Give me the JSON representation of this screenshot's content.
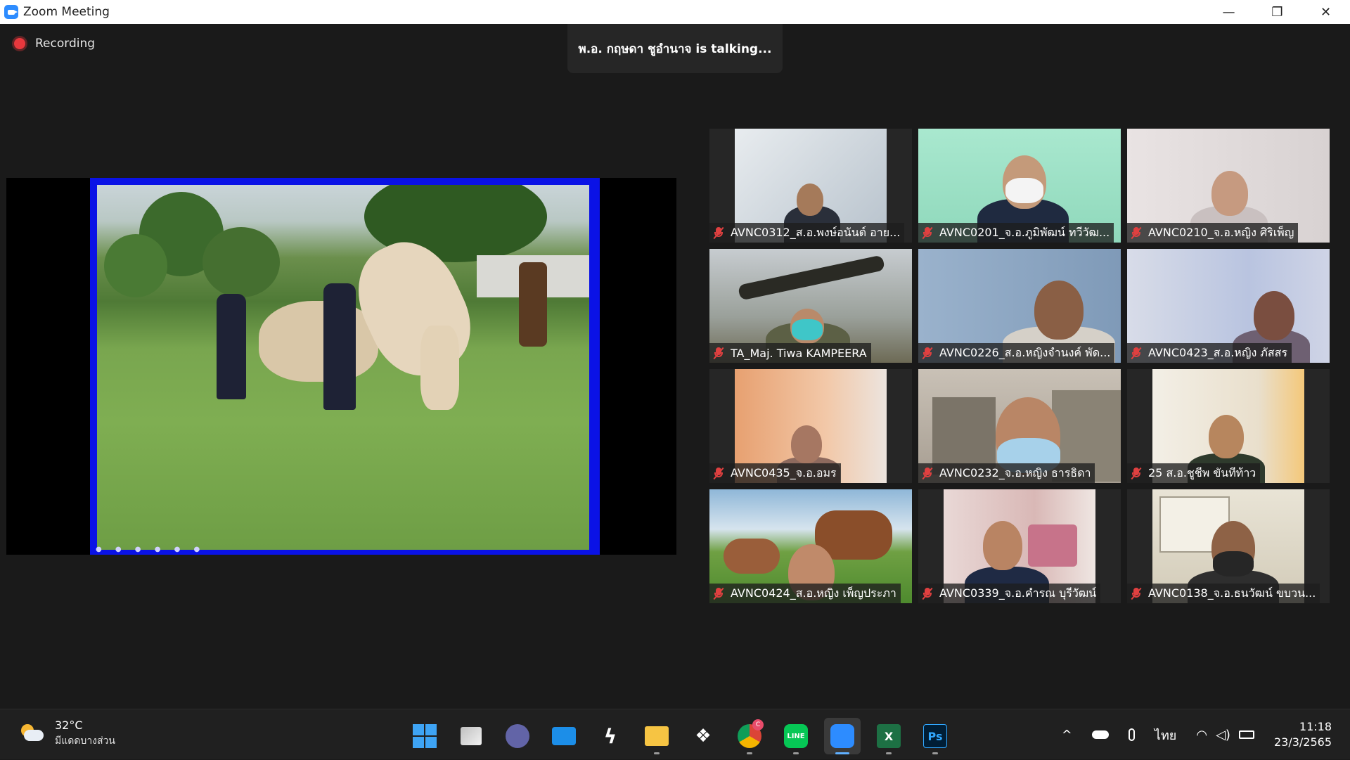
{
  "window": {
    "title": "Zoom Meeting",
    "minimize": "—",
    "restore": "❐",
    "close": "✕"
  },
  "meeting": {
    "recording_label": "Recording",
    "talking_banner": "พ.อ. กฤษดา ชูอำนาจ is  talking..."
  },
  "share": {
    "slide_nav_dots": "● ● ● ● ● ●"
  },
  "participants": [
    {
      "name": "AVNC0312_ส.อ.พงษ์อนันต์ อาย..."
    },
    {
      "name": "AVNC0201_จ.อ.ภูมิพัฒน์ ทวีวัฒ..."
    },
    {
      "name": "AVNC0210_จ.อ.หญิง ศิริเพ็ญ"
    },
    {
      "name": "TA_Maj. Tiwa KAMPEERA"
    },
    {
      "name": "AVNC0226_ส.อ.หญิงจำนงค์ พัด..."
    },
    {
      "name": "AVNC0423_ส.อ.หญิง ภัสสร"
    },
    {
      "name": "AVNC0435_จ.อ.อมร"
    },
    {
      "name": "AVNC0232_จ.อ.หญิง ธารธิดา"
    },
    {
      "name": "25 ส.อ.ชูชีพ ขันทีท้าว"
    },
    {
      "name": "AVNC0424_ส.อ.หญิง เพ็ญประภา"
    },
    {
      "name": "AVNC0339_จ.อ.คำรณ บุรีวัฒน์"
    },
    {
      "name": "AVNC0138_จ.อ.ธนวัฒน์ ขบวน..."
    }
  ],
  "taskbar": {
    "weather_temp": "32°C",
    "weather_desc": "มีแดดบางส่วน",
    "chrome_badge": "C",
    "line_label": "LINE",
    "excel_label": "X",
    "ps_label": "Ps",
    "language": "ไทย",
    "time": "11:18",
    "date": "23/3/2565",
    "tray_chevron": "^"
  }
}
